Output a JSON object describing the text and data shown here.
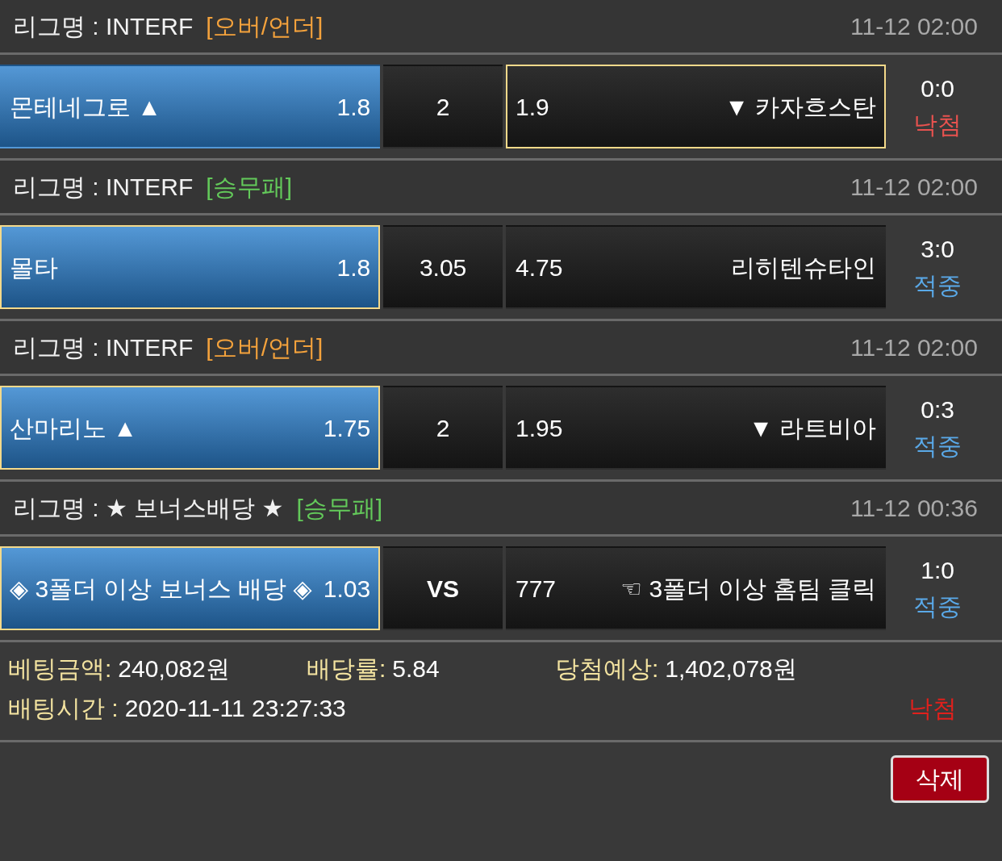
{
  "bets": [
    {
      "league": "리그명 : INTERF",
      "market": {
        "kind": "over_under",
        "label": "[오버/언더]"
      },
      "time": "11-12 02:00",
      "home": {
        "name": "몬테네그로 ▲",
        "odds": "1.8",
        "highlighted": true,
        "selected": false
      },
      "middle": {
        "text": "2",
        "bold": false
      },
      "away": {
        "odds": "1.9",
        "name": "▼ 카자흐스탄",
        "highlighted": false,
        "selected": true
      },
      "score": "0:0",
      "result": {
        "text": "낙첨",
        "won": false
      }
    },
    {
      "league": "리그명 : INTERF",
      "market": {
        "kind": "win_draw_lose",
        "label": "[승무패]"
      },
      "time": "11-12 02:00",
      "home": {
        "name": "몰타",
        "odds": "1.8",
        "highlighted": true,
        "selected": true
      },
      "middle": {
        "text": "3.05",
        "bold": false
      },
      "away": {
        "odds": "4.75",
        "name": "리히텐슈타인",
        "highlighted": false,
        "selected": false
      },
      "score": "3:0",
      "result": {
        "text": "적중",
        "won": true
      }
    },
    {
      "league": "리그명 : INTERF",
      "market": {
        "kind": "over_under",
        "label": "[오버/언더]"
      },
      "time": "11-12 02:00",
      "home": {
        "name": "산마리노 ▲",
        "odds": "1.75",
        "highlighted": true,
        "selected": true
      },
      "middle": {
        "text": "2",
        "bold": false
      },
      "away": {
        "odds": "1.95",
        "name": "▼ 라트비아",
        "highlighted": false,
        "selected": false
      },
      "score": "0:3",
      "result": {
        "text": "적중",
        "won": true
      }
    },
    {
      "league": "리그명 : ★ 보너스배당 ★",
      "market": {
        "kind": "win_draw_lose",
        "label": "[승무패]"
      },
      "time": "11-12 00:36",
      "home": {
        "name": "◈ 3폴더 이상 보너스 배당 ◈",
        "odds": "1.03",
        "highlighted": true,
        "selected": true
      },
      "middle": {
        "text": "VS",
        "bold": true
      },
      "away": {
        "odds": "777",
        "name": "☜ 3폴더 이상 홈팀 클릭",
        "highlighted": false,
        "selected": false
      },
      "score": "1:0",
      "result": {
        "text": "적중",
        "won": true
      }
    }
  ],
  "summary": {
    "amount_label": "베팅금액:",
    "amount": "240,082원",
    "rate_label": "배당률:",
    "rate": "5.84",
    "expected_label": "당첨예상:",
    "expected": "1,402,078원",
    "time_label": "배팅시간 :",
    "time": "2020-11-11 23:27:33",
    "result": {
      "text": "낙첨",
      "won": false
    }
  },
  "delete_button": "삭제"
}
